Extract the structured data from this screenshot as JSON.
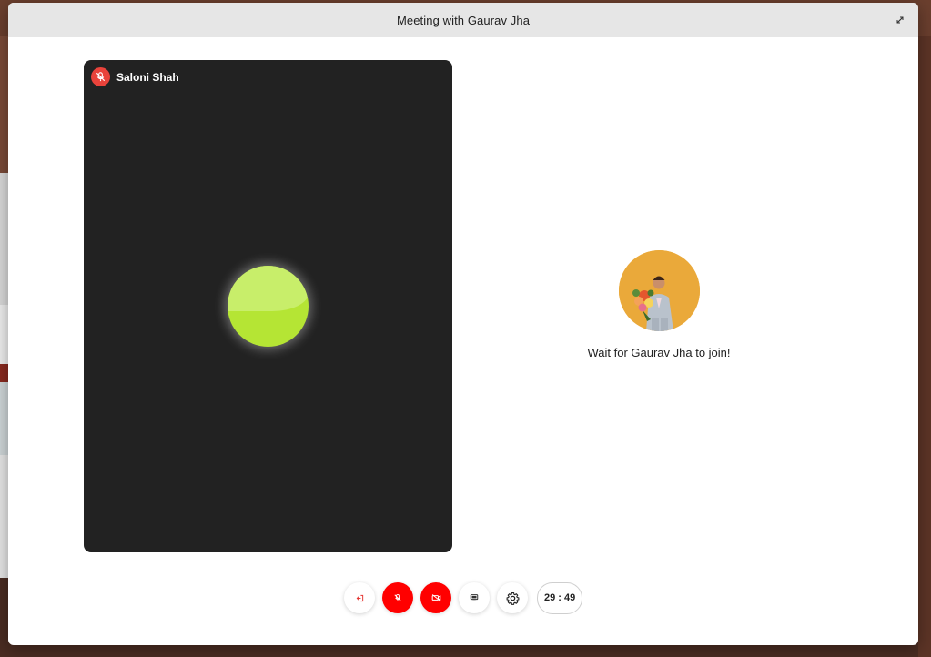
{
  "meeting": {
    "title": "Meeting with Gaurav Jha"
  },
  "local_participant": {
    "name": "Saloni Shah",
    "muted": true
  },
  "remote_participant": {
    "status_text": "Wait for Gaurav Jha to join!"
  },
  "controls": {
    "timer": "29 : 49",
    "buttons": [
      {
        "name": "leave",
        "icon": "leave-icon",
        "active": false
      },
      {
        "name": "mic",
        "icon": "mic-off-icon",
        "active": true
      },
      {
        "name": "camera",
        "icon": "camera-off-icon",
        "active": true
      },
      {
        "name": "screen-share",
        "icon": "screen-share-icon",
        "active": false
      },
      {
        "name": "settings",
        "icon": "gear-icon",
        "active": false
      }
    ]
  },
  "colors": {
    "danger": "#ff0000",
    "mute_badge": "#e9433b",
    "tile_bg": "#222222",
    "avatar_bg": "#eaa93a",
    "orb": "#b5e534"
  }
}
